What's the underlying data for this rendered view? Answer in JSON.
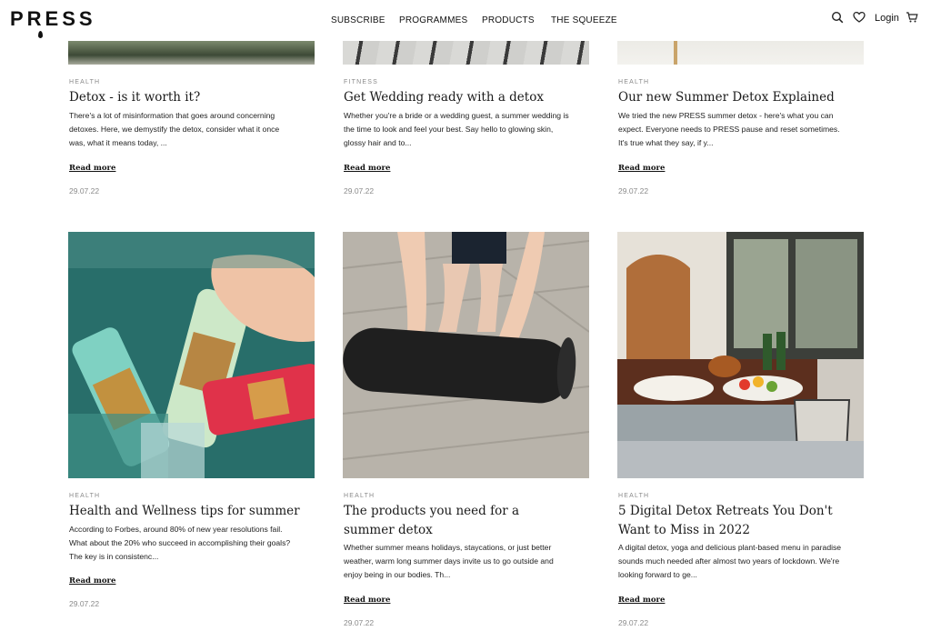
{
  "brand": {
    "logo": "PRESS"
  },
  "nav": {
    "items": [
      "SUBSCRIBE",
      "PROGRAMMES",
      "PRODUCTS",
      "THE SQUEEZE"
    ],
    "login": "Login",
    "icons": [
      "search-icon",
      "heart-icon",
      "cart-icon"
    ]
  },
  "cards_top": [
    {
      "category": "HEALTH",
      "title": "Detox - is it worth it?",
      "excerpt": "There's a lot of misinformation that goes around concerning detoxes. Here, we demystify the detox, consider what it once was, what it means today, ...",
      "read_more": "Read more",
      "date": "29.07.22"
    },
    {
      "category": "FITNESS",
      "title": "Get Wedding ready with a detox",
      "excerpt": "Whether you're a bride or a wedding guest, a summer wedding is the time to look and feel your best.  Say  hello to glowing skin, glossy hair and to...",
      "read_more": "Read more",
      "date": "29.07.22"
    },
    {
      "category": "HEALTH",
      "title": "Our new Summer Detox Explained",
      "excerpt": "We tried the new PRESS summer detox - here's what you can expect.  Everyone needs to PRESS pause and reset sometimes. It's true what they say, if y...",
      "read_more": "Read more",
      "date": "29.07.22"
    }
  ],
  "cards_bottom": [
    {
      "category": "HEALTH",
      "title": "Health and Wellness tips for summer",
      "excerpt": "According to Forbes, around 80% of new year resolutions fail. What about the 20% who succeed in accomplishing their goals? The key is in consistenc...",
      "read_more": "Read more",
      "date": "29.07.22"
    },
    {
      "category": "HEALTH",
      "title": "The products you need for a summer detox",
      "excerpt": "Whether summer means holidays, staycations, or just better weather, warm long summer days invite us to go outside and enjoy being in our bodies. Th...",
      "read_more": "Read more",
      "date": "29.07.22"
    },
    {
      "category": "HEALTH",
      "title": "5 Digital Detox Retreats You Don't Want to Miss in 2022",
      "excerpt": "A digital detox, yoga and delicious plant-based menu in paradise sounds much needed after almost two years of lockdown. We're looking forward to ge...",
      "read_more": "Read more",
      "date": "29.07.22"
    }
  ],
  "colors": {
    "text": "#1a1a1a",
    "muted": "#8a8a8a",
    "background": "#ffffff"
  }
}
